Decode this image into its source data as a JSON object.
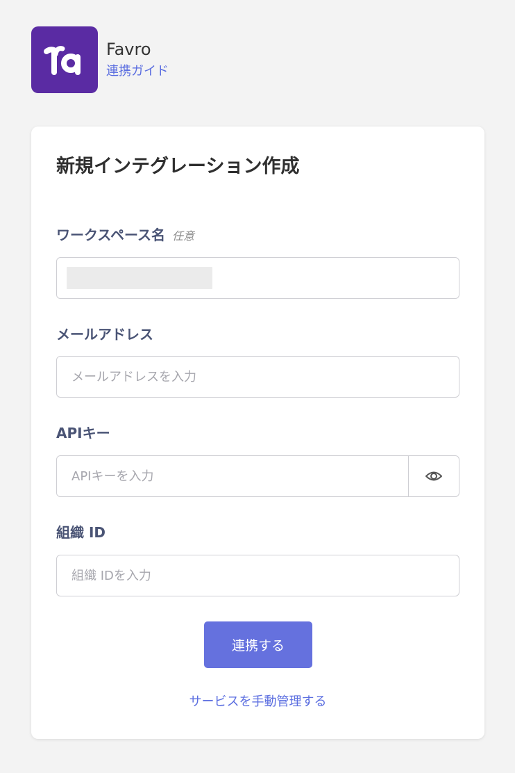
{
  "app": {
    "name": "Favro",
    "guide_link": "連携ガイド",
    "logo_icon": "favro-logo-icon",
    "brand_color": "#5a2ba3"
  },
  "form": {
    "title": "新規インテグレーション作成",
    "workspace": {
      "label": "ワークスペース名",
      "optional": "任意"
    },
    "email": {
      "label": "メールアドレス",
      "placeholder": "メールアドレスを入力",
      "value": ""
    },
    "api_key": {
      "label": "APIキー",
      "placeholder": "APIキーを入力",
      "value": "",
      "toggle_icon": "eye-icon"
    },
    "org_id": {
      "label": "組織 ID",
      "placeholder": "組織 IDを入力",
      "value": ""
    },
    "submit_label": "連携する",
    "manual_link": "サービスを手動管理する",
    "accent_color": "#6571de",
    "link_color": "#5b6ee0"
  }
}
